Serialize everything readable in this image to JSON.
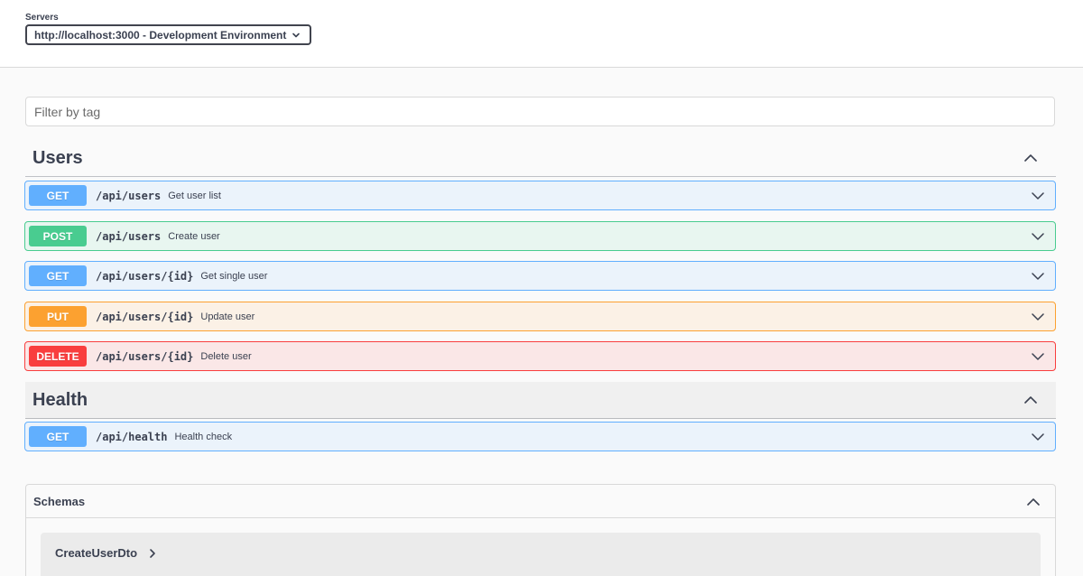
{
  "servers": {
    "label": "Servers",
    "selected": "http://localhost:3000 - Development Environment",
    "icon": "chevron-down-icon"
  },
  "filter": {
    "placeholder": "Filter by tag",
    "value": ""
  },
  "tags": [
    {
      "name": "Users",
      "operations": [
        {
          "method": "GET",
          "path": "/api/users",
          "summary": "Get user list",
          "color": "#61affe"
        },
        {
          "method": "POST",
          "path": "/api/users",
          "summary": "Create user",
          "color": "#49cc90"
        },
        {
          "method": "GET",
          "path": "/api/users/{id}",
          "summary": "Get single user",
          "color": "#61affe"
        },
        {
          "method": "PUT",
          "path": "/api/users/{id}",
          "summary": "Update user",
          "color": "#fca130"
        },
        {
          "method": "DELETE",
          "path": "/api/users/{id}",
          "summary": "Delete user",
          "color": "#f93e3e"
        }
      ]
    },
    {
      "name": "Health",
      "operations": [
        {
          "method": "GET",
          "path": "/api/health",
          "summary": "Health check",
          "color": "#61affe"
        }
      ]
    }
  ],
  "schemas": {
    "title": "Schemas",
    "models": [
      "CreateUserDto"
    ]
  }
}
